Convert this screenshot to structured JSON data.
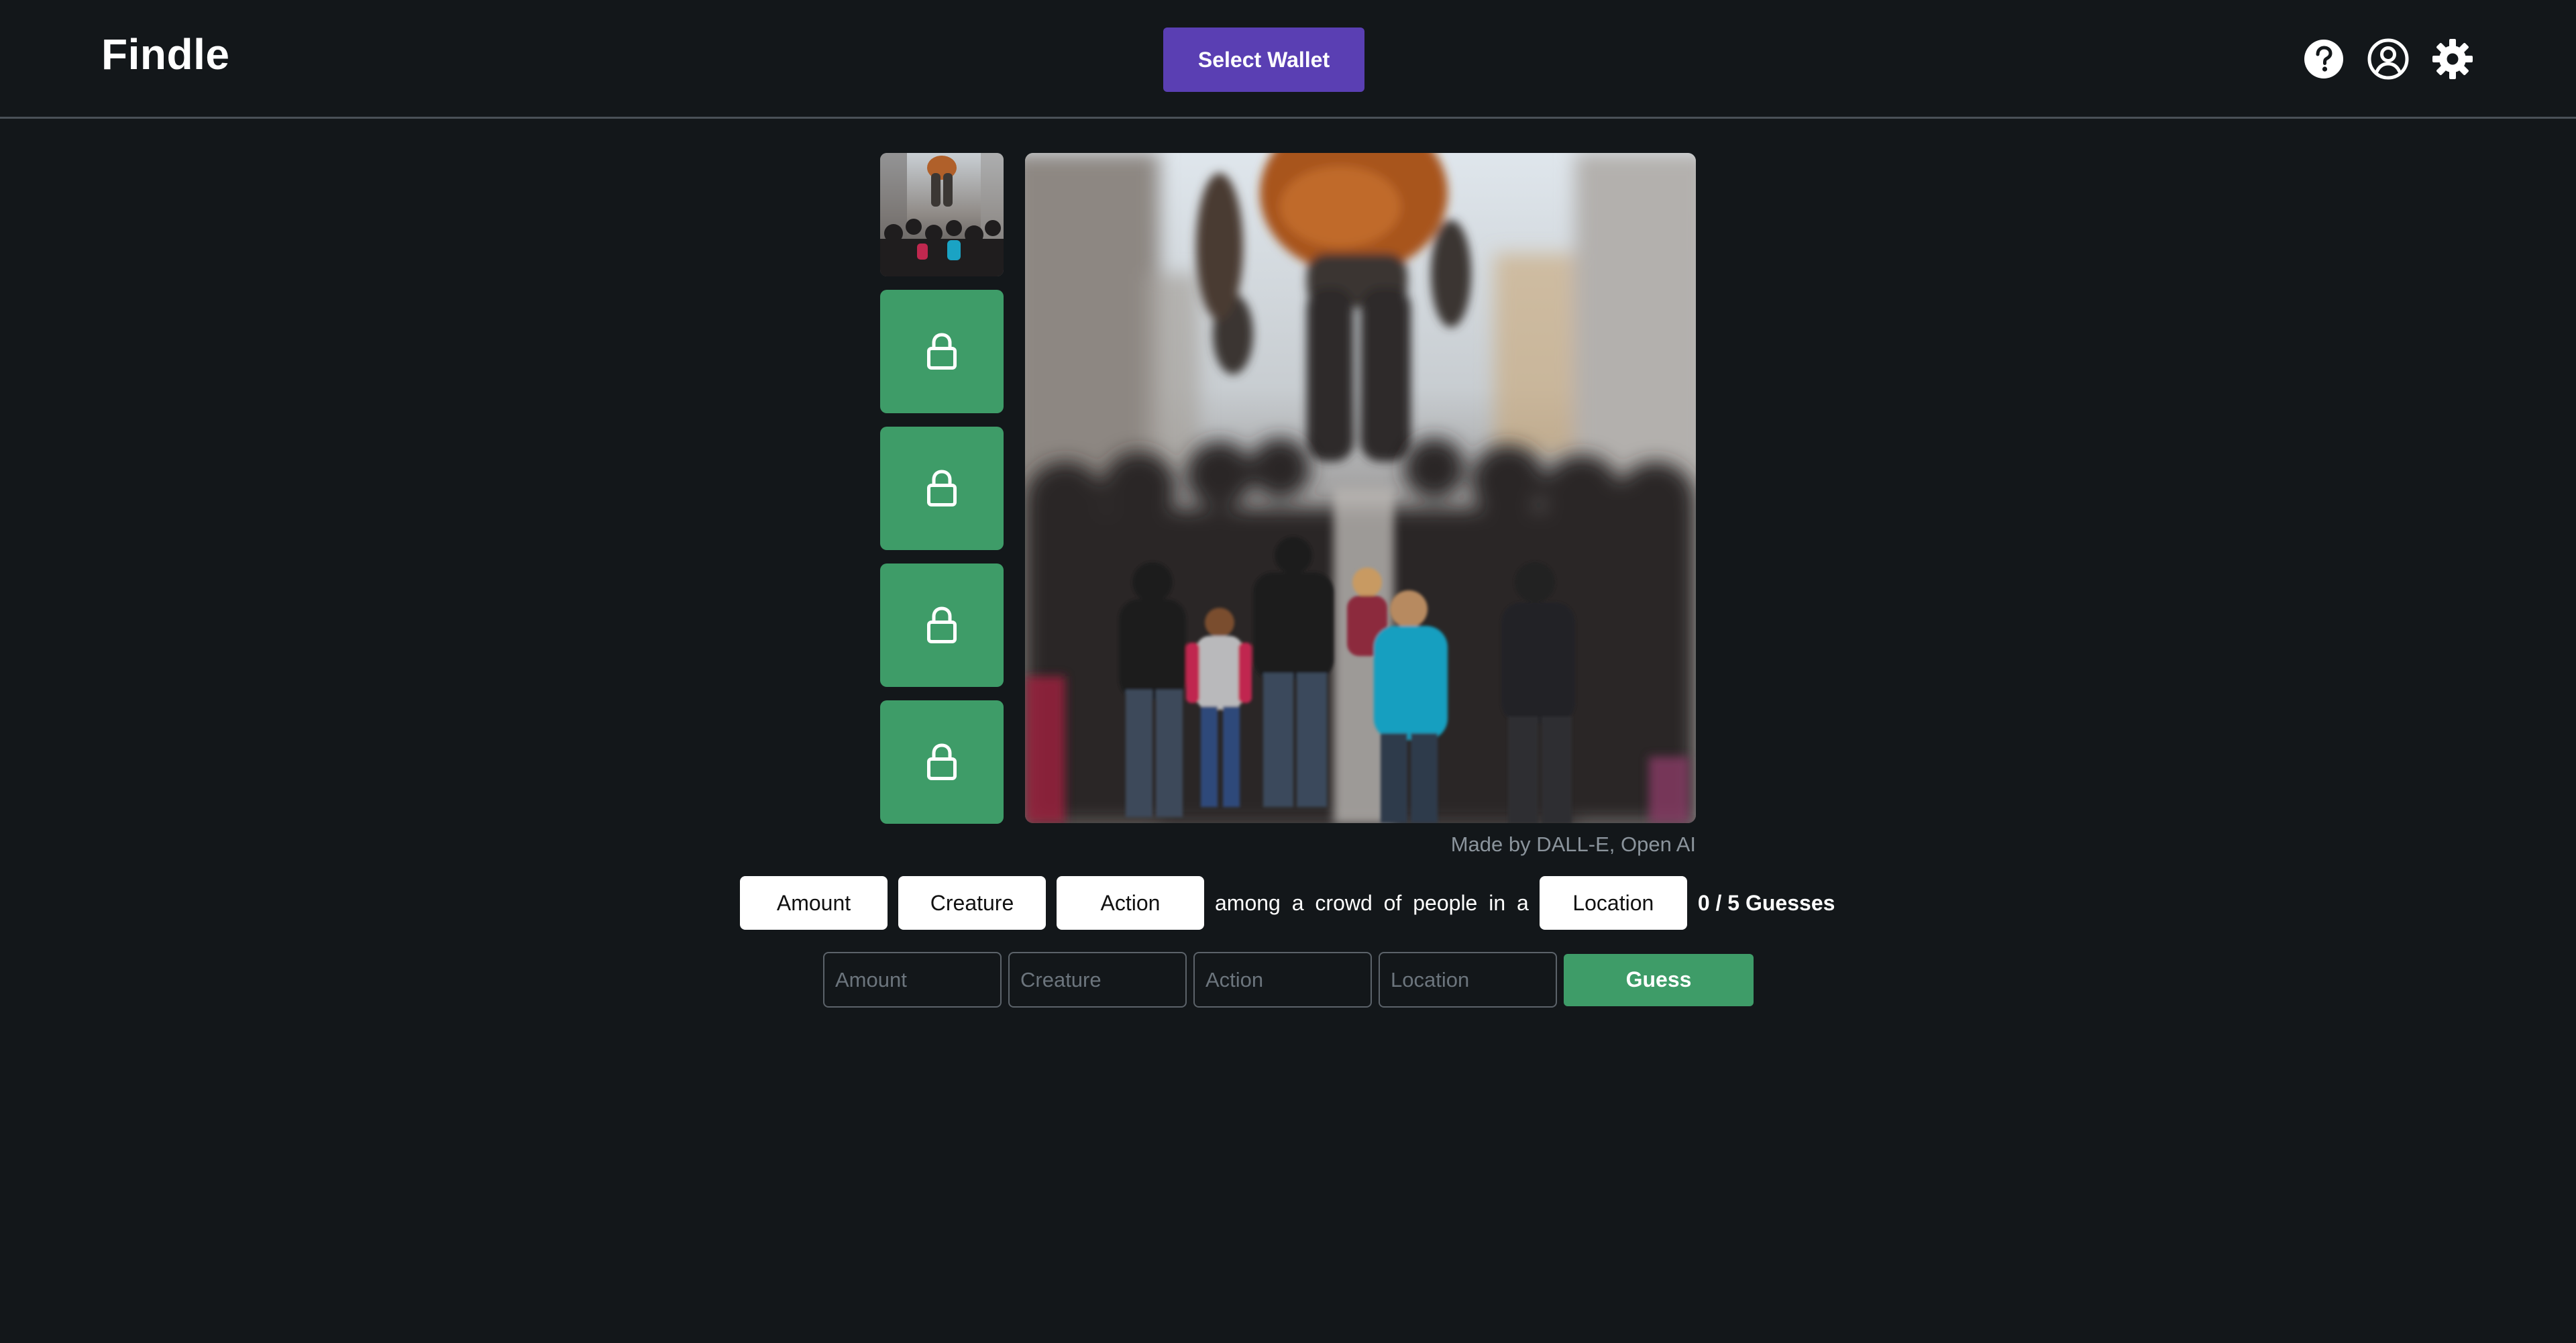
{
  "header": {
    "brand": "Findle",
    "wallet_button": "Select Wallet",
    "icons": [
      "help-icon",
      "user-account-icon",
      "settings-icon"
    ]
  },
  "thumbnails": [
    {
      "state": "revealed",
      "icon": "scene-thumbnail"
    },
    {
      "state": "locked",
      "icon": "lock-icon"
    },
    {
      "state": "locked",
      "icon": "lock-icon"
    },
    {
      "state": "locked",
      "icon": "lock-icon"
    },
    {
      "state": "locked",
      "icon": "lock-icon"
    }
  ],
  "image": {
    "credit": "Made by DALL-E, Open AI"
  },
  "prompt": {
    "chips": {
      "amount": "Amount",
      "creature": "Creature",
      "action": "Action",
      "location": "Location"
    },
    "connector": "among a crowd of people in a",
    "guesses": "0 / 5 Guesses"
  },
  "guess_form": {
    "amount_placeholder": "Amount",
    "creature_placeholder": "Creature",
    "action_placeholder": "Action",
    "location_placeholder": "Location",
    "amount_value": "",
    "creature_value": "",
    "action_value": "",
    "location_value": "",
    "submit_label": "Guess"
  },
  "colors": {
    "background": "#13171a",
    "accent_purple": "#5a3fb3",
    "accent_green": "#3e9c68",
    "divider": "#4a5157"
  }
}
